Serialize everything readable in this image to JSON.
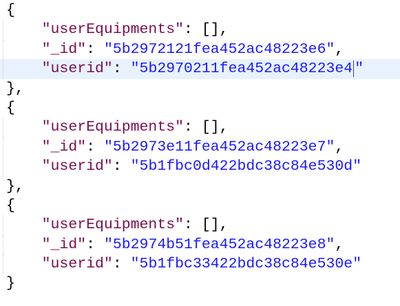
{
  "records": [
    {
      "equip_key": "\"userEquipments\"",
      "equip_val": "[]",
      "id_key": "\"_id\"",
      "id_val": "\"5b2972121fea452ac48223e6\"",
      "userid_key": "\"userid\"",
      "userid_val": "\"5b2970211fea452ac48223e4",
      "userid_close": "\""
    },
    {
      "equip_key": "\"userEquipments\"",
      "equip_val": "[]",
      "id_key": "\"_id\"",
      "id_val": "\"5b2973e11fea452ac48223e7\"",
      "userid_key": "\"userid\"",
      "userid_val": "\"5b1fbc0d422bdc38c84e530d\""
    },
    {
      "equip_key": "\"userEquipments\"",
      "equip_val": "[]",
      "id_key": "\"_id\"",
      "id_val": "\"5b2974b51fea452ac48223e8\"",
      "userid_key": "\"userid\"",
      "userid_val": "\"5b1fbc33422bdc38c84e530e\""
    }
  ],
  "punct": {
    "open": "{",
    "close": "}",
    "close_comma": "},",
    "colon": ": ",
    "comma": ","
  }
}
